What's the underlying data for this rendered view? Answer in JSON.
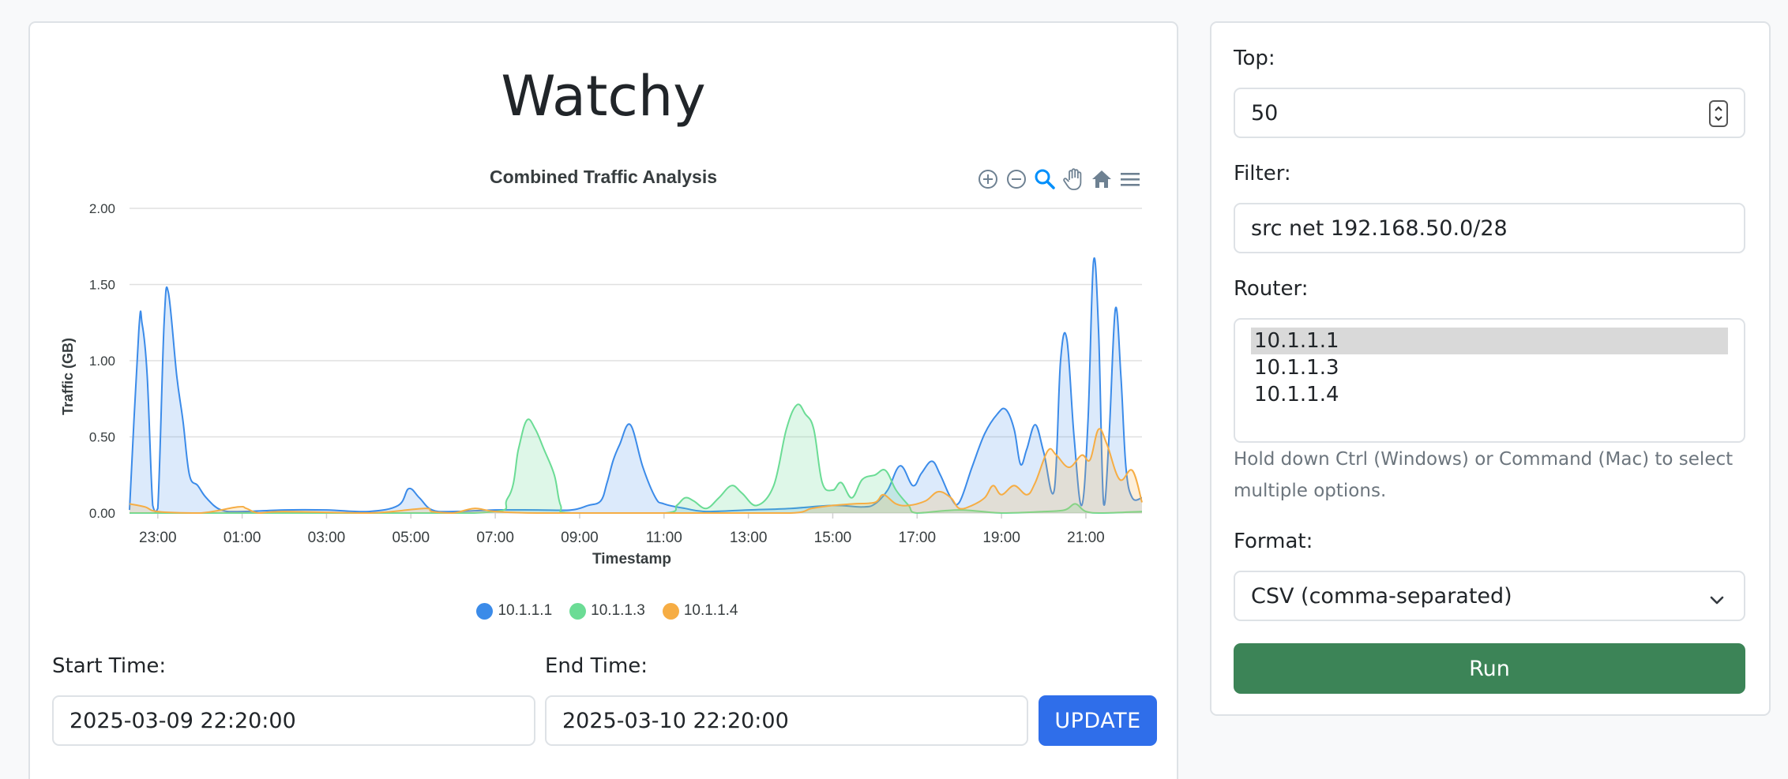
{
  "app": {
    "title": "Watchy"
  },
  "toolbar_icons": [
    "zoom-in-icon",
    "zoom-out-icon",
    "zoom-selection-icon",
    "pan-icon",
    "home-icon",
    "menu-icon"
  ],
  "chart_data": {
    "type": "area",
    "title": "Combined Traffic Analysis",
    "xlabel": "Timestamp",
    "ylabel": "Traffic (GB)",
    "ylim": [
      0,
      2.0
    ],
    "y_ticks": [
      "2.00",
      "1.50",
      "1.00",
      "0.50",
      "0.00"
    ],
    "y_tick_values": [
      2.0,
      1.5,
      1.0,
      0.5,
      0.0
    ],
    "x_range_hours": [
      22.33,
      46.33
    ],
    "x_ticks": [
      "23:00",
      "01:00",
      "03:00",
      "05:00",
      "07:00",
      "09:00",
      "11:00",
      "13:00",
      "15:00",
      "17:00",
      "19:00",
      "21:00"
    ],
    "x_tick_hours": [
      23,
      25,
      27,
      29,
      31,
      33,
      35,
      37,
      39,
      41,
      43,
      45
    ],
    "grid": true,
    "legend_position": "bottom",
    "series": [
      {
        "name": "10.1.1.1",
        "color": "#3b8be9",
        "x": [
          22.33,
          22.55,
          22.63,
          22.75,
          22.88,
          23.0,
          23.15,
          23.25,
          23.45,
          23.6,
          23.75,
          23.95,
          24.15,
          24.5,
          25.0,
          26.0,
          27.0,
          28.0,
          28.7,
          28.95,
          29.2,
          29.5,
          30.0,
          31.0,
          32.0,
          32.8,
          33.2,
          33.5,
          33.65,
          33.8,
          33.95,
          34.2,
          34.5,
          34.8,
          35.0,
          35.5,
          36.0,
          37.0,
          38.0,
          39.0,
          39.7,
          40.0,
          40.3,
          40.6,
          40.9,
          41.1,
          41.35,
          41.55,
          41.8,
          42.0,
          42.3,
          42.6,
          42.9,
          43.1,
          43.3,
          43.45,
          43.6,
          43.8,
          44.0,
          44.25,
          44.4,
          44.55,
          44.72,
          44.9,
          45.05,
          45.18,
          45.3,
          45.42,
          45.55,
          45.7,
          45.83,
          45.95,
          46.1,
          46.33
        ],
        "values": [
          0.02,
          1.2,
          1.24,
          0.9,
          0.05,
          0.03,
          1.25,
          1.45,
          0.9,
          0.6,
          0.25,
          0.18,
          0.1,
          0.02,
          0.01,
          0.02,
          0.02,
          0.01,
          0.05,
          0.16,
          0.1,
          0.02,
          0.01,
          0.02,
          0.02,
          0.02,
          0.05,
          0.08,
          0.2,
          0.35,
          0.45,
          0.58,
          0.3,
          0.1,
          0.06,
          0.03,
          0.01,
          0.02,
          0.03,
          0.05,
          0.04,
          0.06,
          0.15,
          0.31,
          0.18,
          0.26,
          0.34,
          0.25,
          0.1,
          0.07,
          0.3,
          0.52,
          0.65,
          0.68,
          0.55,
          0.32,
          0.42,
          0.58,
          0.4,
          0.15,
          1.0,
          1.14,
          0.5,
          0.05,
          0.6,
          1.65,
          1.2,
          0.06,
          0.5,
          1.34,
          0.9,
          0.3,
          0.1,
          0.1
        ]
      },
      {
        "name": "10.1.1.3",
        "color": "#6bdc95",
        "x": [
          22.33,
          25.0,
          30.5,
          31.3,
          31.55,
          31.75,
          31.95,
          32.15,
          32.4,
          32.55,
          32.8,
          35.0,
          35.3,
          35.5,
          35.7,
          36.0,
          36.3,
          36.6,
          36.85,
          37.2,
          37.6,
          37.9,
          38.15,
          38.35,
          38.55,
          38.75,
          39.0,
          39.2,
          39.45,
          39.7,
          40.0,
          40.25,
          40.5,
          40.8,
          41.0,
          42.0,
          43.0,
          44.0,
          44.5,
          44.75,
          45.0,
          45.4,
          46.33
        ],
        "values": [
          0.0,
          0.0,
          0.0,
          0.1,
          0.42,
          0.61,
          0.55,
          0.42,
          0.25,
          0.05,
          0.0,
          0.0,
          0.05,
          0.1,
          0.08,
          0.03,
          0.1,
          0.18,
          0.13,
          0.05,
          0.18,
          0.55,
          0.71,
          0.65,
          0.55,
          0.2,
          0.15,
          0.2,
          0.1,
          0.22,
          0.25,
          0.28,
          0.15,
          0.05,
          0.0,
          0.02,
          0.0,
          0.01,
          0.02,
          0.06,
          0.01,
          0.0,
          0.01
        ]
      },
      {
        "name": "10.1.1.4",
        "color": "#f6ad44",
        "x": [
          22.33,
          22.7,
          23.0,
          24.0,
          24.9,
          25.1,
          25.4,
          26.0,
          28.0,
          29.3,
          29.5,
          30.0,
          30.5,
          31.0,
          32.0,
          34.0,
          36.0,
          38.0,
          38.5,
          39.0,
          39.5,
          40.0,
          40.2,
          40.5,
          40.8,
          41.2,
          41.5,
          41.8,
          42.0,
          42.3,
          42.6,
          42.8,
          43.0,
          43.3,
          43.6,
          43.8,
          44.1,
          44.3,
          44.6,
          44.9,
          45.1,
          45.3,
          45.5,
          45.8,
          46.1,
          46.33
        ],
        "values": [
          0.06,
          0.04,
          0.01,
          0.0,
          0.04,
          0.03,
          0.0,
          0.01,
          0.0,
          0.03,
          0.01,
          0.0,
          0.03,
          0.01,
          0.0,
          0.0,
          0.0,
          0.0,
          0.03,
          0.05,
          0.06,
          0.07,
          0.12,
          0.06,
          0.05,
          0.08,
          0.14,
          0.1,
          0.03,
          0.05,
          0.1,
          0.18,
          0.12,
          0.18,
          0.12,
          0.2,
          0.41,
          0.38,
          0.3,
          0.38,
          0.35,
          0.55,
          0.45,
          0.22,
          0.28,
          0.07
        ]
      }
    ]
  },
  "time_range": {
    "start_label": "Start Time:",
    "start_value": "2025-03-09 22:20:00",
    "end_label": "End Time:",
    "end_value": "2025-03-10 22:20:00",
    "update_button": "UPDATE"
  },
  "query_panel": {
    "top_label": "Top:",
    "top_value": "50",
    "filter_label": "Filter:",
    "filter_value": "src net 192.168.50.0/28",
    "router_label": "Router:",
    "routers": [
      "10.1.1.1",
      "10.1.1.3",
      "10.1.1.4"
    ],
    "router_selected": "10.1.1.1",
    "router_help": "Hold down Ctrl (Windows) or Command (Mac) to select multiple options.",
    "format_label": "Format:",
    "format_value": "CSV (comma-separated)",
    "run_button": "Run"
  }
}
